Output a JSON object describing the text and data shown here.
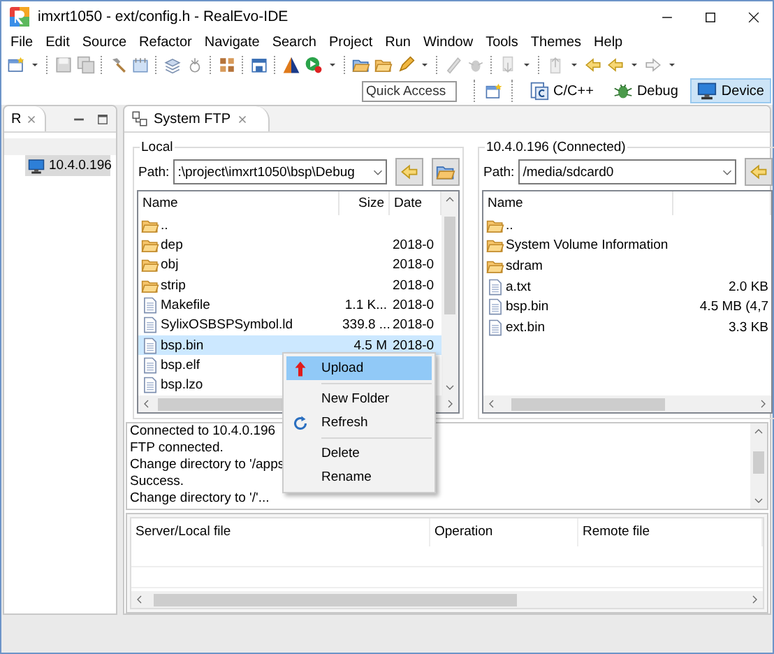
{
  "window": {
    "title": "imxrt1050 - ext/config.h - RealEvo-IDE"
  },
  "menu": [
    "File",
    "Edit",
    "Source",
    "Refactor",
    "Navigate",
    "Search",
    "Project",
    "Run",
    "Window",
    "Tools",
    "Themes",
    "Help"
  ],
  "quick_access": {
    "placeholder": "Quick Access"
  },
  "perspectives": [
    {
      "label": "C/C++",
      "selected": false
    },
    {
      "label": "Debug",
      "selected": false
    },
    {
      "label": "Device",
      "selected": true
    }
  ],
  "device_view": {
    "tab": "R",
    "devices": [
      {
        "label": "10.4.0.196",
        "selected": true
      }
    ]
  },
  "ftp_view": {
    "tab": "System FTP",
    "local": {
      "title": "Local",
      "path_label": "Path:",
      "path": ":\\project\\imxrt1050\\bsp\\Debug",
      "columns": [
        "Name",
        "Size",
        "Date"
      ],
      "rows": [
        {
          "kind": "folder",
          "name": "..",
          "selected": false
        },
        {
          "kind": "folder",
          "name": "dep",
          "date": "2018-0",
          "selected": false
        },
        {
          "kind": "folder",
          "name": "obj",
          "date": "2018-0",
          "selected": false
        },
        {
          "kind": "folder",
          "name": "strip",
          "date": "2018-0",
          "selected": false
        },
        {
          "kind": "file",
          "name": "Makefile",
          "size": "1.1 K...",
          "date": "2018-0",
          "selected": false
        },
        {
          "kind": "file",
          "name": "SylixOSBSPSymbol.ld",
          "size": "339.8 ...",
          "date": "2018-0",
          "selected": false
        },
        {
          "kind": "file",
          "name": "bsp.bin",
          "size": "4.5 M",
          "date": "2018-0",
          "selected": true
        },
        {
          "kind": "file",
          "name": "bsp.elf",
          "selected": false
        },
        {
          "kind": "file",
          "name": "bsp.lzo",
          "selected": false
        }
      ]
    },
    "remote": {
      "title": "10.4.0.196 (Connected)",
      "path_label": "Path:",
      "path": "/media/sdcard0",
      "columns": [
        "Name"
      ],
      "rows": [
        {
          "kind": "folder",
          "name": "..",
          "selected": false
        },
        {
          "kind": "folder",
          "name": "System Volume Information",
          "selected": false
        },
        {
          "kind": "folder",
          "name": "sdram",
          "selected": false
        },
        {
          "kind": "file",
          "name": "a.txt",
          "size": "2.0 KB",
          "selected": false
        },
        {
          "kind": "file",
          "name": "bsp.bin",
          "size": "4.5 MB (4,7",
          "selected": false
        },
        {
          "kind": "file",
          "name": "ext.bin",
          "size": "3.3 KB",
          "selected": false
        }
      ]
    },
    "log": [
      "Connected to 10.4.0.196",
      "FTP connected.",
      "Change directory to '/apps",
      "Success.",
      "Change directory to '/'..."
    ],
    "transfers": {
      "columns": [
        "Server/Local file",
        "Operation",
        "Remote file"
      ]
    }
  },
  "context_menu": [
    {
      "kind": "upload",
      "label": "Upload",
      "selected": true
    },
    {
      "kind": "separator"
    },
    {
      "kind": "plain",
      "label": "New Folder",
      "selected": false
    },
    {
      "kind": "refresh",
      "label": "Refresh",
      "selected": false
    },
    {
      "kind": "separator"
    },
    {
      "kind": "plain",
      "label": "Delete",
      "selected": false
    },
    {
      "kind": "plain",
      "label": "Rename",
      "selected": false
    }
  ]
}
